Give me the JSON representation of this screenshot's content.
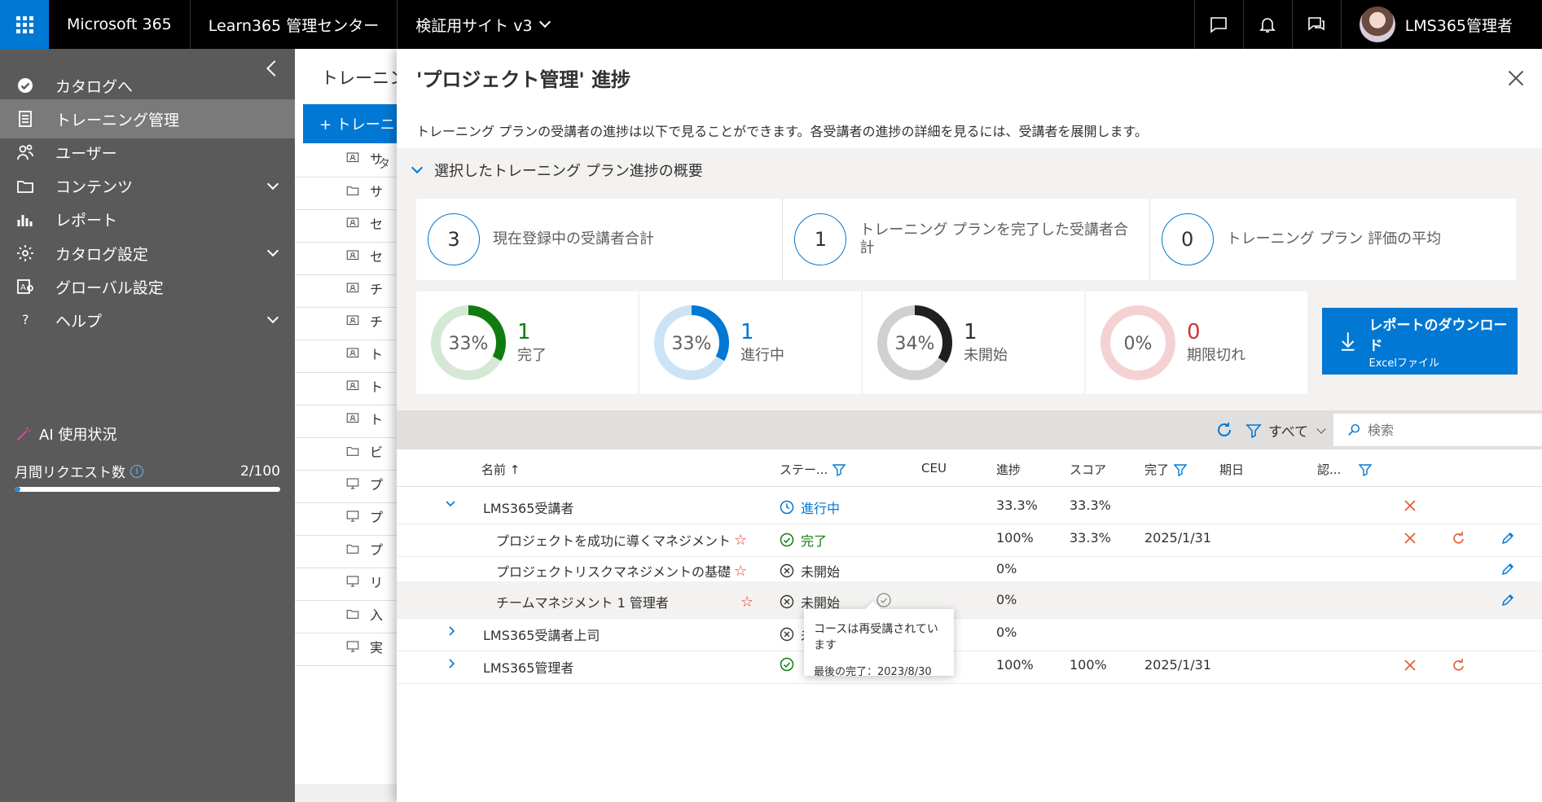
{
  "topbar": {
    "app_name": "Microsoft 365",
    "admin_center": "Learn365 管理センター",
    "site": "検証用サイト v3",
    "user_name": "LMS365管理者"
  },
  "nav": {
    "items": [
      {
        "label": "カタログへ",
        "icon": "check-circle-icon"
      },
      {
        "label": "トレーニング管理",
        "icon": "clipboard-icon",
        "active": true
      },
      {
        "label": "ユーザー",
        "icon": "users-icon"
      },
      {
        "label": "コンテンツ",
        "icon": "folder-icon",
        "expandable": true
      },
      {
        "label": "レポート",
        "icon": "bar-chart-icon"
      },
      {
        "label": "カタログ設定",
        "icon": "gear-icon",
        "expandable": true
      },
      {
        "label": "グローバル設定",
        "icon": "global-settings-icon"
      },
      {
        "label": "ヘルプ",
        "icon": "question-icon",
        "expandable": true
      }
    ],
    "ai_usage_label": "AI 使用状況",
    "monthly_requests_label": "月間リクエスト数",
    "monthly_requests_value": "2/100",
    "monthly_requests_fraction": 0.02
  },
  "background": {
    "header": "トレーニン",
    "new_button": "+ トレーニ",
    "column_header": "タ",
    "rows": [
      {
        "text": "サ",
        "icon": "course-icon"
      },
      {
        "text": "サ",
        "icon": "folder-icon"
      },
      {
        "text": "セ",
        "icon": "course-icon"
      },
      {
        "text": "セ",
        "icon": "course-icon"
      },
      {
        "text": "チ",
        "icon": "course-icon"
      },
      {
        "text": "チ",
        "icon": "course-icon"
      },
      {
        "text": "ト",
        "icon": "course-icon"
      },
      {
        "text": "ト",
        "icon": "course-icon"
      },
      {
        "text": "ト",
        "icon": "course-icon"
      },
      {
        "text": "ビ",
        "icon": "folder-icon"
      },
      {
        "text": "プ",
        "icon": "monitor-icon"
      },
      {
        "text": "プ",
        "icon": "monitor-icon"
      },
      {
        "text": "プ",
        "icon": "folder-icon"
      },
      {
        "text": "リ",
        "icon": "monitor-icon"
      },
      {
        "text": "入",
        "icon": "folder-icon"
      },
      {
        "text": "実",
        "icon": "monitor-icon"
      }
    ]
  },
  "panel": {
    "title": "'プロジェクト管理' 進捗",
    "description": "トレーニング プランの受講者の進捗は以下で見ることができます。各受講者の進捗の詳細を見るには、受講者を展開します。",
    "summary_header": "選択したトレーニング プラン進捗の概要",
    "stats": [
      {
        "value": "3",
        "label": "現在登録中の受講者合計"
      },
      {
        "value": "1",
        "label": "トレーニング プランを完了した受講者合計"
      },
      {
        "value": "0",
        "label": "トレーニング プラン 評価の平均"
      }
    ],
    "donuts": [
      {
        "pct_label": "33%",
        "fraction": 0.33,
        "count": "1",
        "caption": "完了",
        "color": "#107c10",
        "track": "#d5e8d4",
        "num_color": "#107c10"
      },
      {
        "pct_label": "33%",
        "fraction": 0.33,
        "count": "1",
        "caption": "進行中",
        "color": "#0078d4",
        "track": "#cce3f5",
        "num_color": "#0078d4"
      },
      {
        "pct_label": "34%",
        "fraction": 0.34,
        "count": "1",
        "caption": "未開始",
        "color": "#201f1e",
        "track": "#d2d0ce",
        "num_color": "#323130"
      },
      {
        "pct_label": "0%",
        "fraction": 0,
        "count": "0",
        "caption": "期限切れ",
        "color": "#d13438",
        "track": "#f4d2d3",
        "num_color": "#d13438"
      }
    ],
    "download": {
      "label": "レポートのダウンロード",
      "sub": "Excelファイル"
    },
    "toolbar": {
      "filter_label": "すべて",
      "search_placeholder": "検索"
    },
    "columns": {
      "name": "名前 ↑",
      "status": "ステー...",
      "ceu": "CEU",
      "progress": "進捗",
      "score": "スコア",
      "completed": "完了",
      "due": "期日",
      "cert": "認..."
    },
    "rows": [
      {
        "name": "LMS365受講者",
        "level": 0,
        "expanded": true,
        "status": "進行中",
        "status_type": "inprogress",
        "progress": "33.3%",
        "score": "33.3%",
        "completed": "",
        "delete": true,
        "reset": false,
        "edit": false
      },
      {
        "name": "プロジェクトを成功に導くマネジメント",
        "level": 1,
        "star": true,
        "status": "完了",
        "status_type": "done",
        "progress": "100%",
        "score": "33.3%",
        "completed": "2025/1/31",
        "delete": true,
        "reset": true,
        "edit": true
      },
      {
        "name": "プロジェクトリスクマネジメントの基礎",
        "level": 1,
        "star": true,
        "status": "未開始",
        "status_type": "notstarted",
        "progress": "0%",
        "score": "",
        "completed": "",
        "delete": false,
        "reset": false,
        "edit": true
      },
      {
        "name": "チームマネジメント 1 管理者",
        "level": 1,
        "star": true,
        "status": "未開始",
        "status_type": "notstarted",
        "progress": "0%",
        "score": "",
        "completed": "",
        "retake": true,
        "highlight": true,
        "delete": false,
        "reset": false,
        "edit": true
      },
      {
        "name": "LMS365受講者上司",
        "level": 0,
        "expanded": false,
        "status": "未開始",
        "status_type": "notstarted",
        "progress": "0%",
        "score": "",
        "completed": "",
        "delete": false,
        "reset": false,
        "edit": false
      },
      {
        "name": "LMS365管理者",
        "level": 0,
        "expanded": false,
        "status": "",
        "status_type": "done",
        "progress": "100%",
        "score": "100%",
        "completed": "2025/1/31",
        "delete": true,
        "reset": true,
        "edit": false
      }
    ],
    "tooltip": {
      "line1": "コースは再受講されています",
      "line2": "最後の完了：2023/8/30"
    }
  }
}
